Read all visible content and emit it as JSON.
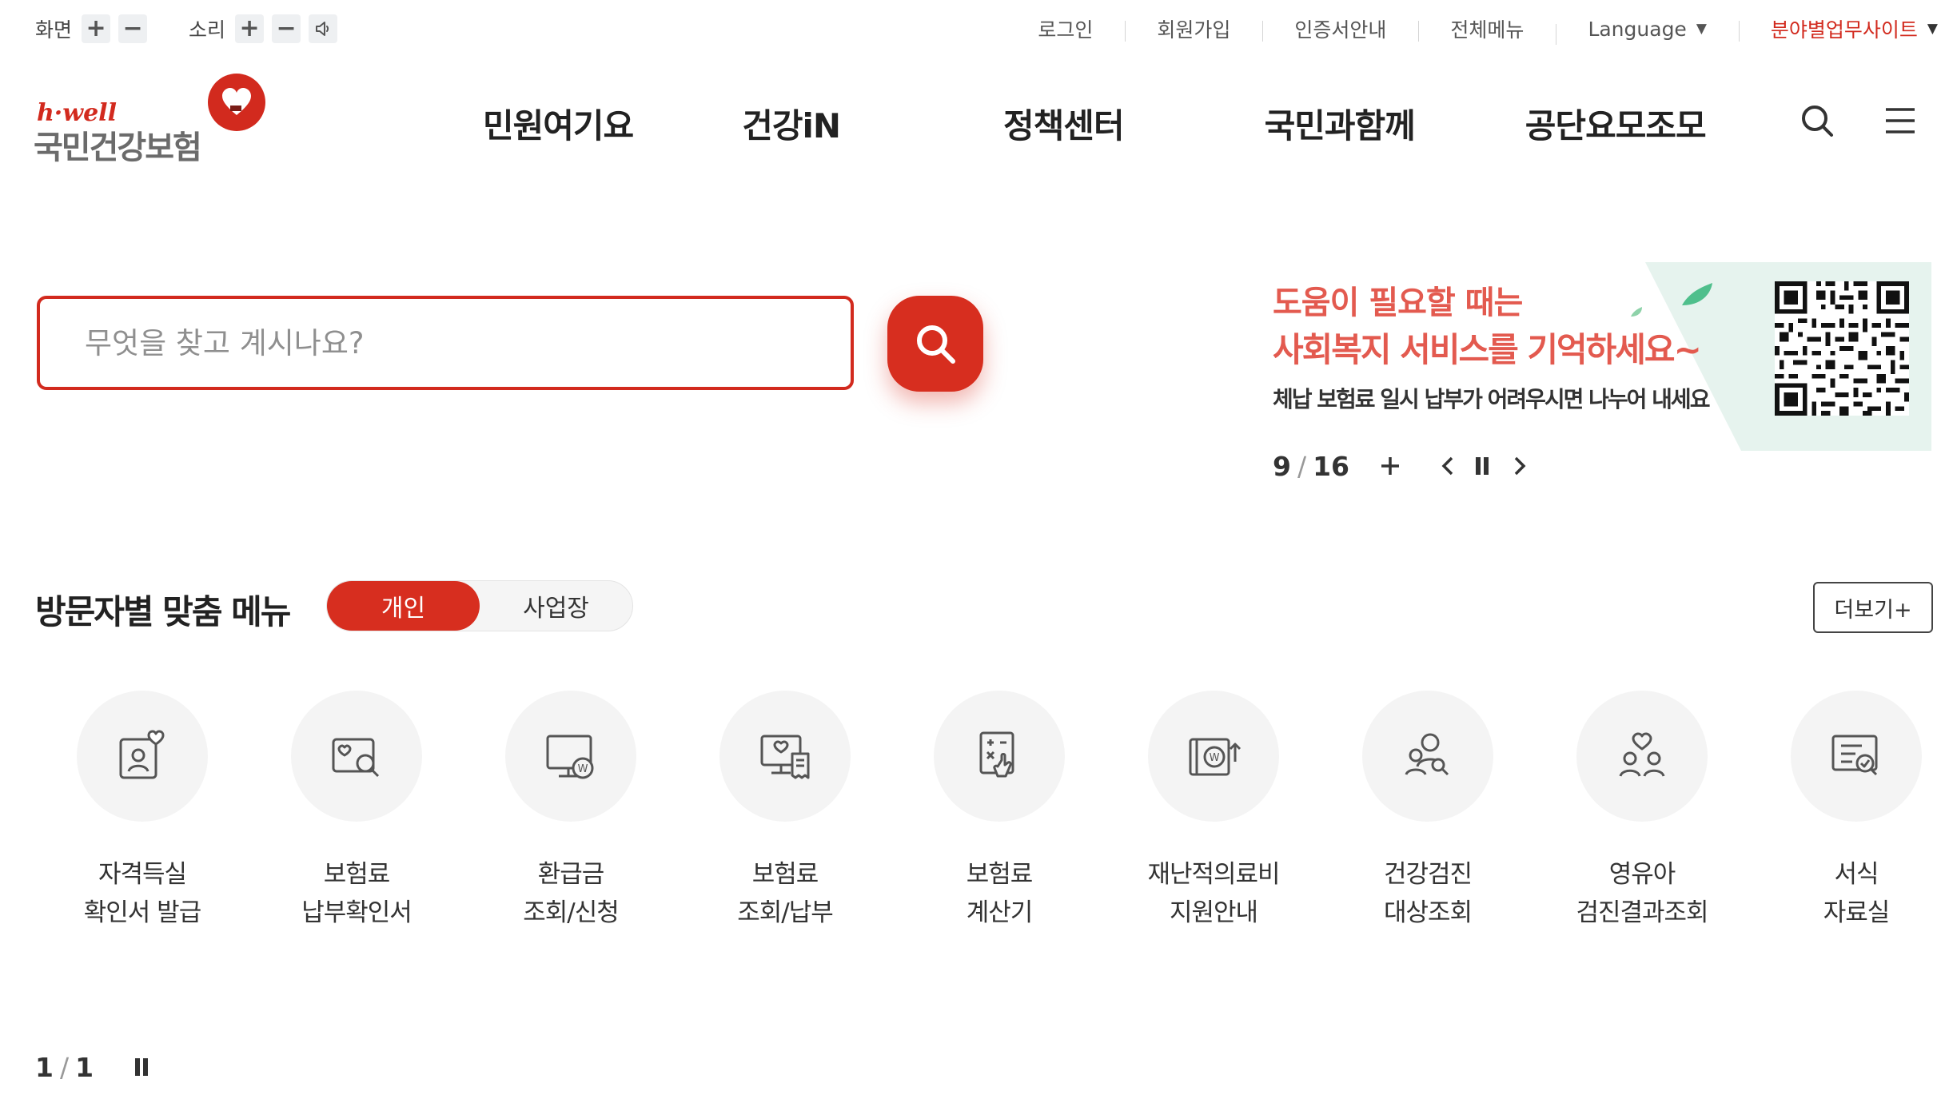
{
  "util": {
    "screen_label": "화면",
    "sound_label": "소리",
    "plus": "+",
    "minus": "−",
    "links": [
      "로그인",
      "회원가입",
      "인증서안내",
      "전체메뉴",
      "Language"
    ],
    "site_link": "분야별업무사이트"
  },
  "logo": {
    "brand": "h·well",
    "name": "국민건강보험"
  },
  "gnb": [
    "민원여기요",
    "건강iN",
    "정책센터",
    "국민과함께",
    "공단요모조모"
  ],
  "search": {
    "placeholder": "무엇을 찾고 계시나요?"
  },
  "banner": {
    "line1": "도움이 필요할 때는",
    "line2": "사회복지 서비스를 기억하세요~",
    "line3": "체납 보험료 일시 납부가 어려우시면 나누어 내세요",
    "current": "9",
    "total": "16",
    "separator": "/",
    "plus": "+"
  },
  "menu": {
    "title": "방문자별 맞춤 메뉴",
    "toggle": [
      "개인",
      "사업장"
    ],
    "active_toggle": "개인",
    "more": "더보기+",
    "items": [
      {
        "line1": "자격득실",
        "line2": "확인서 발급",
        "icon": "person-heart-icon"
      },
      {
        "line1": "보험료",
        "line2": "납부확인서",
        "icon": "card-search-icon"
      },
      {
        "line1": "환급금",
        "line2": "조회/신청",
        "icon": "monitor-won-icon"
      },
      {
        "line1": "보험료",
        "line2": "조회/납부",
        "icon": "monitor-receipt-icon"
      },
      {
        "line1": "보험료",
        "line2": "계산기",
        "icon": "calculator-hand-icon"
      },
      {
        "line1": "재난적의료비",
        "line2": "지원안내",
        "icon": "book-won-up-icon"
      },
      {
        "line1": "건강검진",
        "line2": "대상조회",
        "icon": "people-search-icon"
      },
      {
        "line1": "영유아",
        "line2": "검진결과조회",
        "icon": "family-heart-icon"
      },
      {
        "line1": "서식",
        "line2": "자료실",
        "icon": "document-check-icon"
      }
    ],
    "current": "1",
    "total": "1",
    "separator": "/"
  },
  "colors": {
    "accent": "#d72e1f",
    "banner_text": "#e35a4f",
    "banner_bg": "#e6f3ee"
  }
}
